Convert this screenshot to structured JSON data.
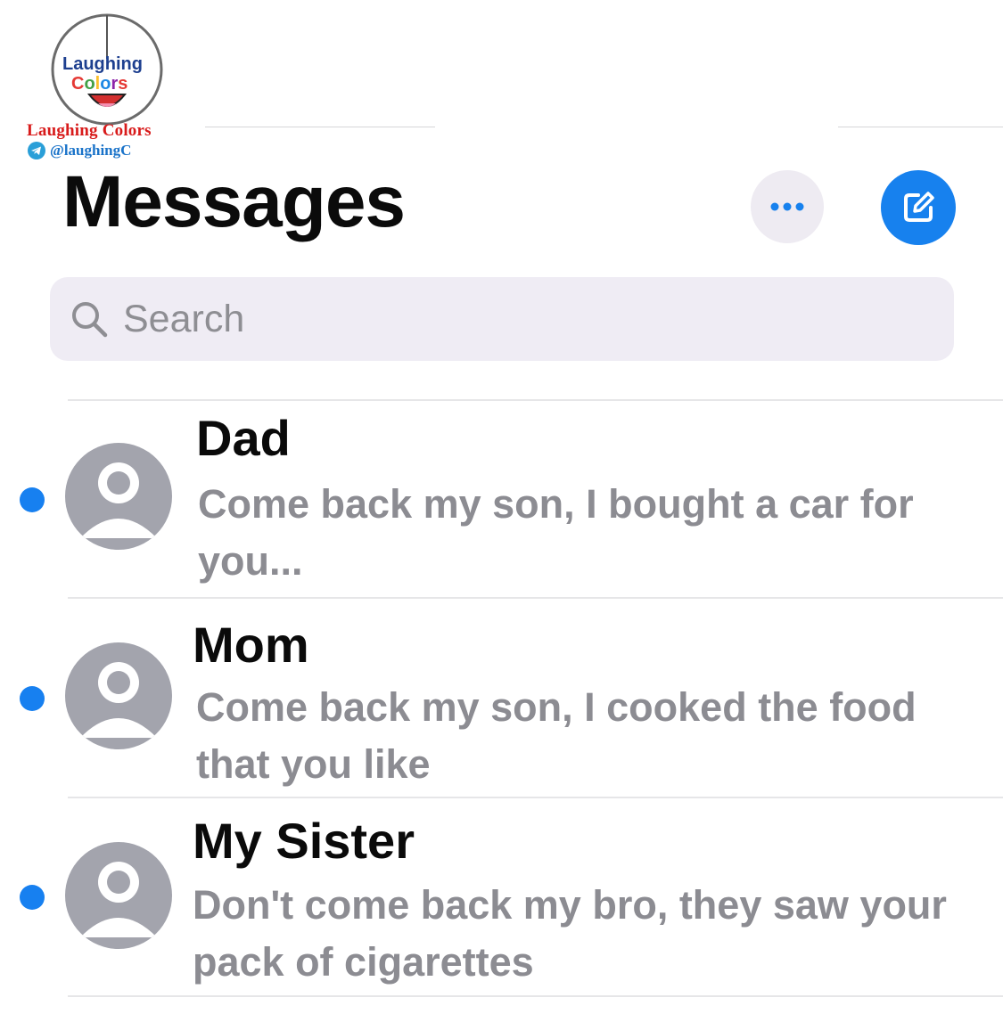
{
  "watermark": {
    "logo_word_top": "Laughing",
    "logo_word_bottom": "Colors",
    "name": "Laughing Colors",
    "handle": "@laughingC"
  },
  "header": {
    "title": "Messages",
    "more_icon": "ellipsis-icon",
    "compose_icon": "compose-icon",
    "accent_color": "#1781ee"
  },
  "search": {
    "placeholder": "Search",
    "icon": "search-icon"
  },
  "conversations": [
    {
      "name": "Dad",
      "preview": "Come back my son, I bought a car for you...",
      "unread": true
    },
    {
      "name": "Mom",
      "preview": "Come back my son, I cooked the food that you like",
      "unread": true
    },
    {
      "name": "My Sister",
      "preview": "Don't come back my bro, they saw your pack of cigarettes",
      "unread": true
    }
  ]
}
